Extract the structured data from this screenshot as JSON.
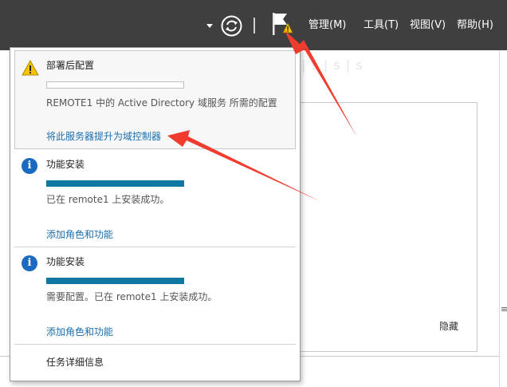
{
  "toolbar": {
    "menu": [
      {
        "label": "管理(M)"
      },
      {
        "label": "工具(T)"
      },
      {
        "label": "视图(V)"
      },
      {
        "label": "帮助(H)"
      }
    ],
    "icons": [
      "chevron-down-icon",
      "refresh-icon",
      "notification-flag-icon"
    ]
  },
  "notifications": {
    "items": [
      {
        "type": "warning",
        "icon": "warning-icon",
        "title": "部署后配置",
        "progress": 0,
        "message": "REMOTE1 中的 Active Directory 域服务 所需的配置",
        "link": "将此服务器提升为域控制器"
      },
      {
        "type": "info",
        "icon": "info-icon",
        "title": "功能安装",
        "progress": 1,
        "message": "已在 remote1 上安装成功。",
        "link": "添加角色和功能"
      },
      {
        "type": "info",
        "icon": "info-icon",
        "title": "功能安装",
        "progress": 1,
        "message": "需要配置。已在 remote1 上安装成功。",
        "link": "添加角色和功能"
      }
    ],
    "footer_link": "任务详细信息"
  },
  "background": {
    "hide_label": "隐藏",
    "scroll_grip": "≡",
    "partial_text": "| s | s | s"
  },
  "colors": {
    "topbar": "#3f3f3f",
    "link": "#1a6fb0",
    "progress": "#0e78a3",
    "info_icon": "#1b6ac2",
    "warning_icon": "#f5c400",
    "annotation_arrow": "#f03c2e"
  }
}
